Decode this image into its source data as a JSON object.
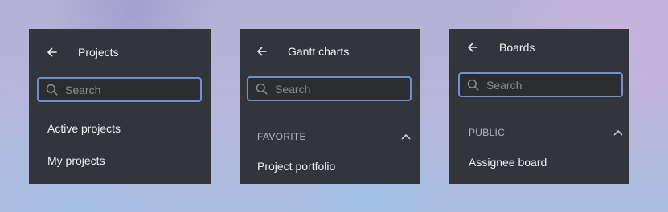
{
  "panels": [
    {
      "title": "Projects",
      "search_placeholder": "Search",
      "items": [
        "Active projects",
        "My projects"
      ]
    },
    {
      "title": "Gantt charts",
      "search_placeholder": "Search",
      "section": "FAVORITE",
      "items": [
        "Project portfolio"
      ]
    },
    {
      "title": "Boards",
      "search_placeholder": "Search",
      "section": "PUBLIC",
      "items": [
        "Assignee board"
      ]
    }
  ],
  "icons": {
    "back": "arrow-left-icon",
    "search": "search-icon",
    "collapse": "chevron-up-icon"
  },
  "colors": {
    "panel_bg": "#323539",
    "search_border": "#6f8fd9"
  }
}
